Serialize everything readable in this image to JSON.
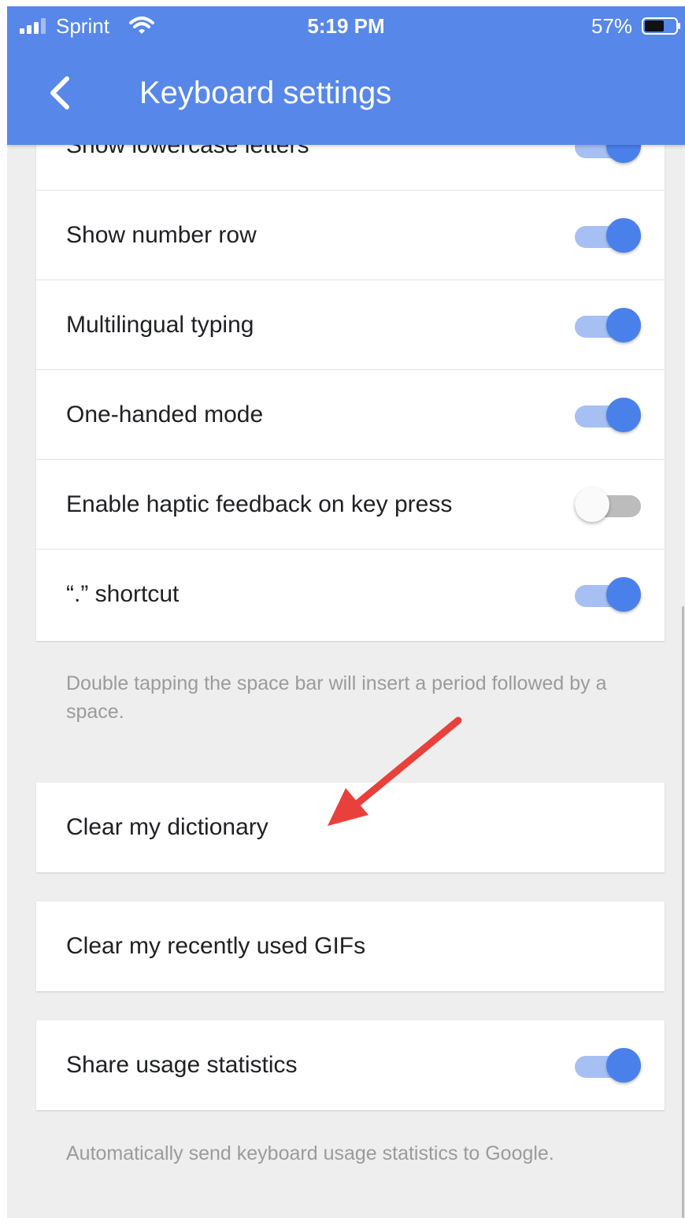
{
  "status_bar": {
    "carrier": "Sprint",
    "time": "5:19 PM",
    "battery": "57%"
  },
  "header": {
    "title": "Keyboard settings"
  },
  "settings": [
    {
      "label": "Show lowercase letters",
      "toggle": "on"
    },
    {
      "label": "Show number row",
      "toggle": "on"
    },
    {
      "label": "Multilingual typing",
      "toggle": "on"
    },
    {
      "label": "One-handed mode",
      "toggle": "on"
    },
    {
      "label": "Enable haptic feedback on key press",
      "toggle": "off"
    },
    {
      "label": "“.” shortcut",
      "toggle": "on"
    }
  ],
  "period_note": "Double tapping the space bar will insert a period followed by a space.",
  "clear_dictionary": "Clear my dictionary",
  "clear_gifs": "Clear my recently used GIFs",
  "usage_stats": {
    "label": "Share usage statistics",
    "toggle": "on"
  },
  "usage_note": "Automatically send keyboard usage statistics to Google.",
  "colors": {
    "header": "#5787e8",
    "toggle_on": "#4a80ea",
    "annotation_arrow": "#e8413c"
  },
  "icons": [
    "signal-icon",
    "wifi-icon",
    "battery-icon",
    "back-arrow-icon"
  ]
}
